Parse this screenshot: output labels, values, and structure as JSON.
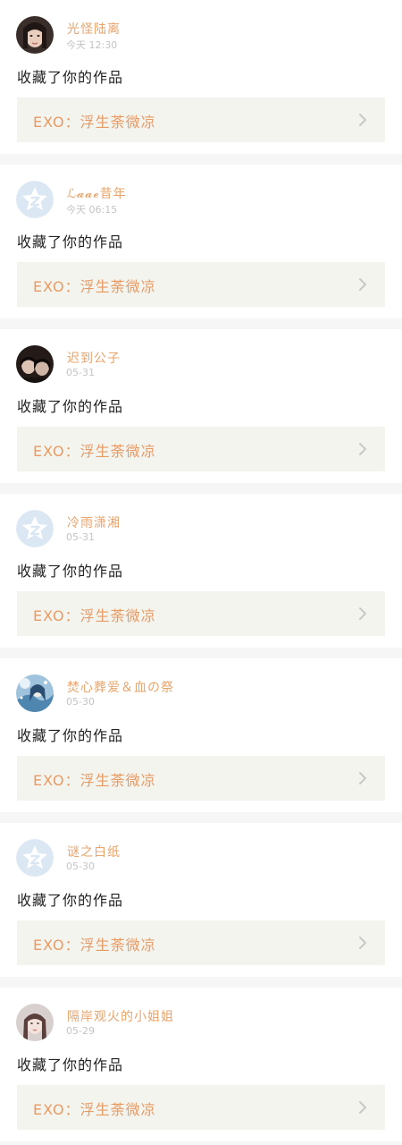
{
  "notifications": [
    {
      "username": "光怪陆离",
      "time": "今天 12:30",
      "action": "收藏了你的作品",
      "work_title": "EXO：浮生荼微凉",
      "avatar": "girl-portrait-dark-hair"
    },
    {
      "username": "ℒ𝓪𝓪𝓮昔年",
      "time": "今天 06:15",
      "action": "收藏了你的作品",
      "work_title": "EXO：浮生荼微凉",
      "avatar": "default-star-avatar"
    },
    {
      "username": "迟到公子",
      "time": "05-31",
      "action": "收藏了你的作品",
      "work_title": "EXO：浮生荼微凉",
      "avatar": "two-people-photo"
    },
    {
      "username": "冷雨潇湘",
      "time": "05-31",
      "action": "收藏了你的作品",
      "work_title": "EXO：浮生荼微凉",
      "avatar": "default-star-avatar"
    },
    {
      "username": "焚心葬爱＆血の祭",
      "time": "05-30",
      "action": "收藏了你的作品",
      "work_title": "EXO：浮生荼微凉",
      "avatar": "anime-blue-illustration"
    },
    {
      "username": "谜之白纸",
      "time": "05-30",
      "action": "收藏了你的作品",
      "work_title": "EXO：浮生荼微凉",
      "avatar": "default-star-avatar"
    },
    {
      "username": "隔岸观火的小姐姐",
      "time": "05-29",
      "action": "收藏了你的作品",
      "work_title": "EXO：浮生荼微凉",
      "avatar": "girl-portrait-light"
    }
  ],
  "colors": {
    "username": "#e8a46b",
    "work_title": "#e89a63",
    "work_card_bg": "#f4f4ef",
    "separator": "#f6f6f6",
    "default_avatar_bg": "#dce7f4",
    "default_avatar_fg": "#ffffff"
  }
}
